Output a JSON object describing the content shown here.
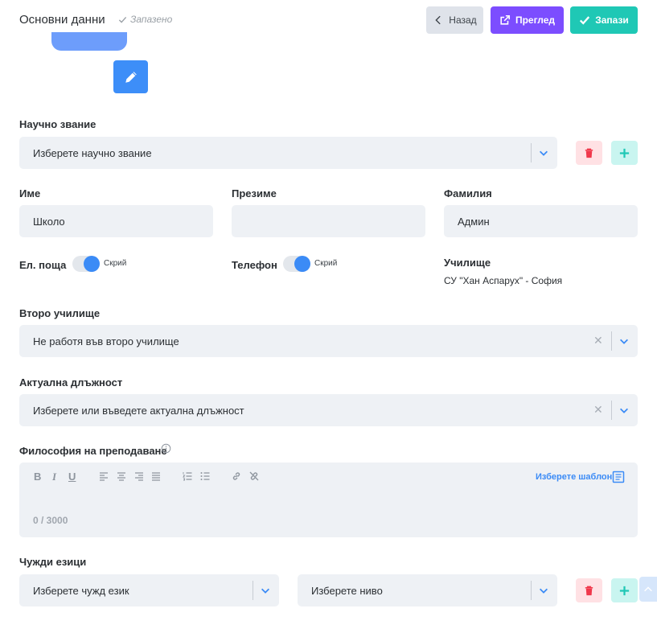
{
  "header": {
    "title": "Основни данни",
    "status": "Запазено",
    "back_label": "Назад",
    "preview_label": "Преглед",
    "save_label": "Запази"
  },
  "academic_title": {
    "label": "Научно звание",
    "placeholder": "Изберете научно звание"
  },
  "first_name": {
    "label": "Име",
    "value": "Школо"
  },
  "middle_name": {
    "label": "Презиме",
    "value": ""
  },
  "last_name": {
    "label": "Фамилия",
    "value": "Админ"
  },
  "email": {
    "label": "Ел. поща",
    "toggle_label": "Скрий",
    "hidden": true
  },
  "phone": {
    "label": "Телефон",
    "toggle_label": "Скрий",
    "hidden": true
  },
  "school": {
    "label": "Училище",
    "value": "СУ \"Хан Аспарух\" - София"
  },
  "second_school": {
    "label": "Второ училище",
    "value": "Не работя във второ училище"
  },
  "current_position": {
    "label": "Актуална длъжност",
    "placeholder": "Изберете или въведете актуална длъжност"
  },
  "teaching_philosophy": {
    "label": "Философия на преподаване",
    "template_link": "Изберете шаблон",
    "counter": "0 / 3000",
    "toolbar": [
      "bold-icon",
      "italic-icon",
      "underline-icon",
      "align-left-icon",
      "align-center-icon",
      "align-right-icon",
      "align-justify-icon",
      "ordered-list-icon",
      "bullet-list-icon",
      "link-icon",
      "unlink-icon"
    ]
  },
  "foreign_languages": {
    "label": "Чужди езици",
    "language_placeholder": "Изберете чужд език",
    "level_placeholder": "Изберете ниво"
  },
  "colors": {
    "preview": "#7c4dff",
    "save": "#1fc8b5",
    "accent": "#3b8bf6",
    "danger": "#f0384b"
  }
}
